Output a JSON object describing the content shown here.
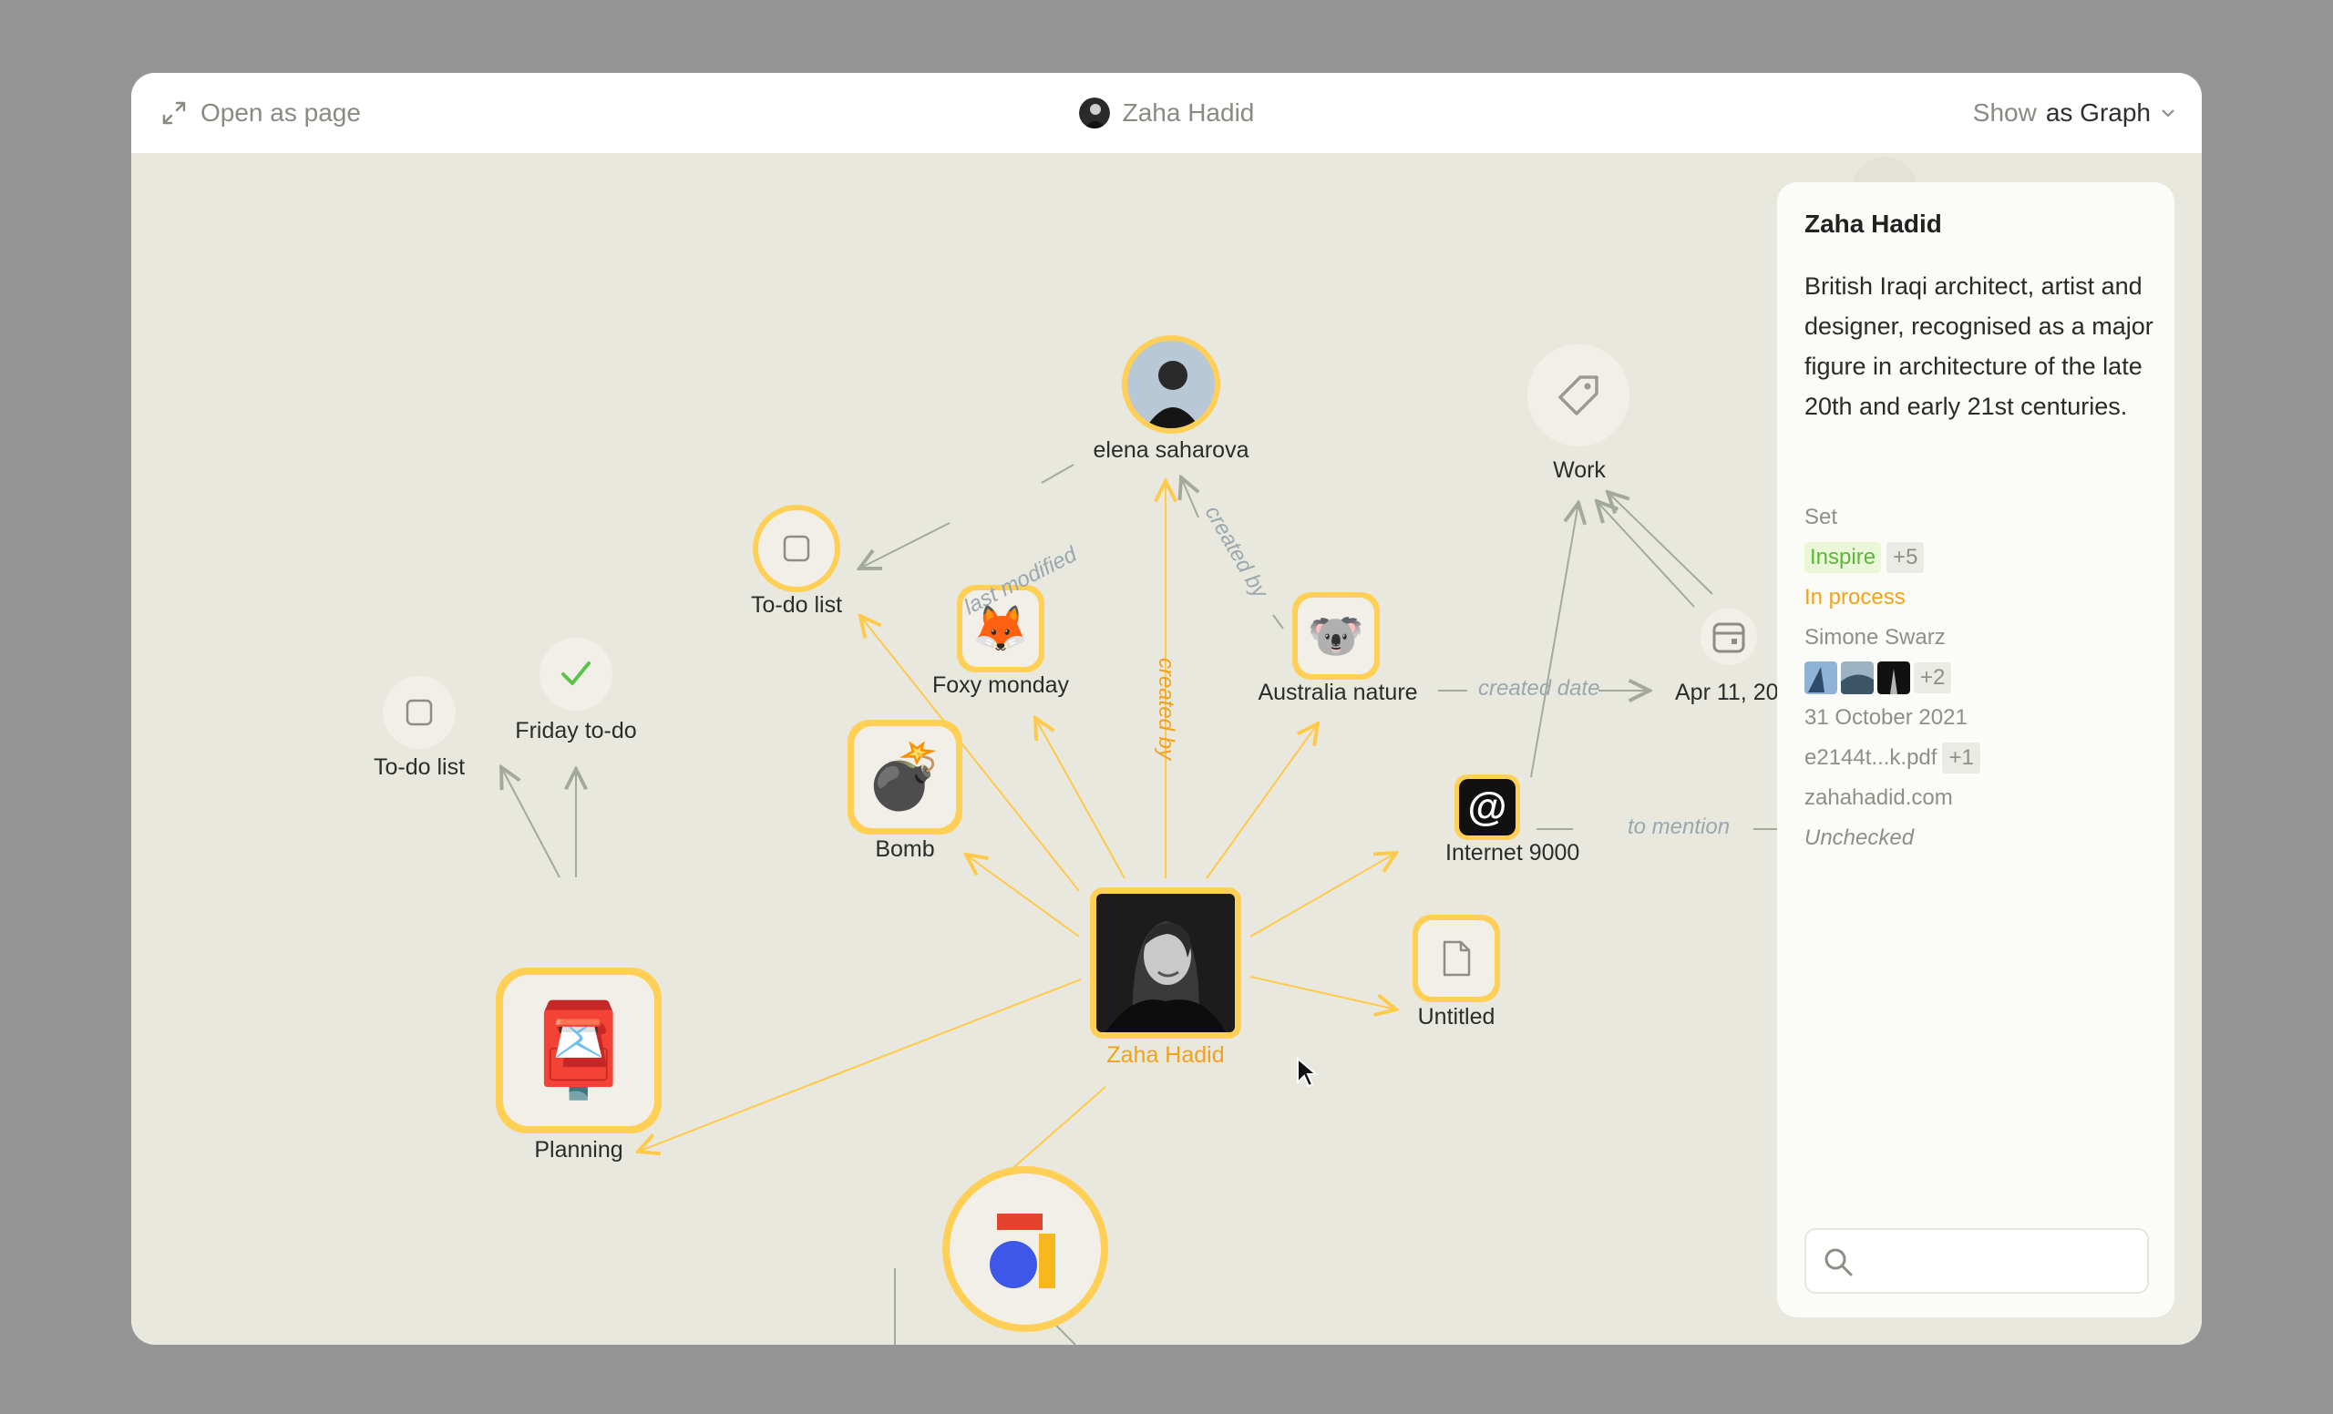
{
  "titlebar": {
    "open_as_page": "Open as page",
    "object_name": "Zaha Hadid",
    "show_label": "Show",
    "mode_label": "as Graph"
  },
  "graph": {
    "nodes": {
      "center": "Zaha Hadid",
      "elena": "elena saharova",
      "todo_top": "To-do list",
      "foxy": "Foxy monday",
      "australia": "Australia nature",
      "work": "Work",
      "apr": "Apr 11, 20",
      "bomb": "Bomb",
      "internet": "Internet 9000",
      "untitled": "Untitled",
      "todo_left": "To-do list",
      "friday": "Friday to-do",
      "planning": "Planning"
    },
    "edge_labels": {
      "last_modified": "last modified",
      "created_by_center": "created by",
      "created_by_australia": "created by",
      "created_date": "created date",
      "to_mention": "to mention"
    }
  },
  "panel": {
    "title": "Zaha Hadid",
    "description": "British Iraqi architect, artist and designer, recognised as a major figure in architecture of the late 20th and early 21st centuries.",
    "set_label": "Set",
    "tag": "Inspire",
    "tag_more": "+5",
    "status": "In process",
    "creator": "Simone Swarz",
    "images_more": "+2",
    "date": "31 October 2021",
    "file": "e2144t...k.pdf",
    "file_more": "+1",
    "url": "zahahadid.com",
    "checkbox": "Unchecked"
  },
  "colors": {
    "accent": "#ffcf56",
    "accent_text": "#f1a21a",
    "edge_gray": "#a7aea0"
  }
}
